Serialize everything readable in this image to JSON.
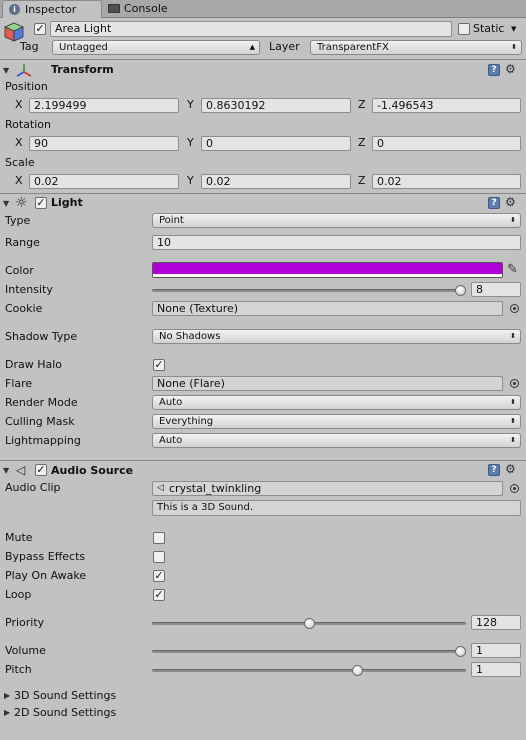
{
  "tabs": [
    {
      "label": "Inspector"
    },
    {
      "label": "Console"
    }
  ],
  "object": {
    "name": "Area Light",
    "static_label": "Static",
    "tag_label": "Tag",
    "tag_value": "Untagged",
    "layer_label": "Layer",
    "layer_value": "TransparentFX"
  },
  "transform": {
    "title": "Transform",
    "position_label": "Position",
    "rotation_label": "Rotation",
    "scale_label": "Scale",
    "x": "X",
    "y": "Y",
    "z": "Z",
    "position": {
      "x": "2.199499",
      "y": "0.8630192",
      "z": "-1.496543"
    },
    "rotation": {
      "x": "90",
      "y": "0",
      "z": "0"
    },
    "scale": {
      "x": "0.02",
      "y": "0.02",
      "z": "0.02"
    }
  },
  "light": {
    "title": "Light",
    "type_label": "Type",
    "type_value": "Point",
    "range_label": "Range",
    "range_value": "10",
    "color_label": "Color",
    "color": "#b000d8",
    "intensity_label": "Intensity",
    "intensity_value": "8",
    "intensity_fraction": 1.0,
    "cookie_label": "Cookie",
    "cookie_value": "None (Texture)",
    "shadow_label": "Shadow Type",
    "shadow_value": "No Shadows",
    "halo_label": "Draw Halo",
    "halo_checked": true,
    "flare_label": "Flare",
    "flare_value": "None (Flare)",
    "render_label": "Render Mode",
    "render_value": "Auto",
    "culling_label": "Culling Mask",
    "culling_value": "Everything",
    "lightmap_label": "Lightmapping",
    "lightmap_value": "Auto"
  },
  "audio": {
    "title": "Audio Source",
    "clip_label": "Audio Clip",
    "clip_value": "crystal_twinkling",
    "info": "This is a 3D Sound.",
    "mute_label": "Mute",
    "mute_checked": false,
    "bypass_label": "Bypass Effects",
    "bypass_checked": false,
    "play_label": "Play On Awake",
    "play_checked": true,
    "loop_label": "Loop",
    "loop_checked": true,
    "priority_label": "Priority",
    "priority_value": "128",
    "priority_fraction": 0.5,
    "volume_label": "Volume",
    "volume_value": "1",
    "volume_fraction": 1.0,
    "pitch_label": "Pitch",
    "pitch_value": "1",
    "pitch_fraction": 0.66,
    "sound3d_label": "3D Sound Settings",
    "sound2d_label": "2D Sound Settings"
  }
}
